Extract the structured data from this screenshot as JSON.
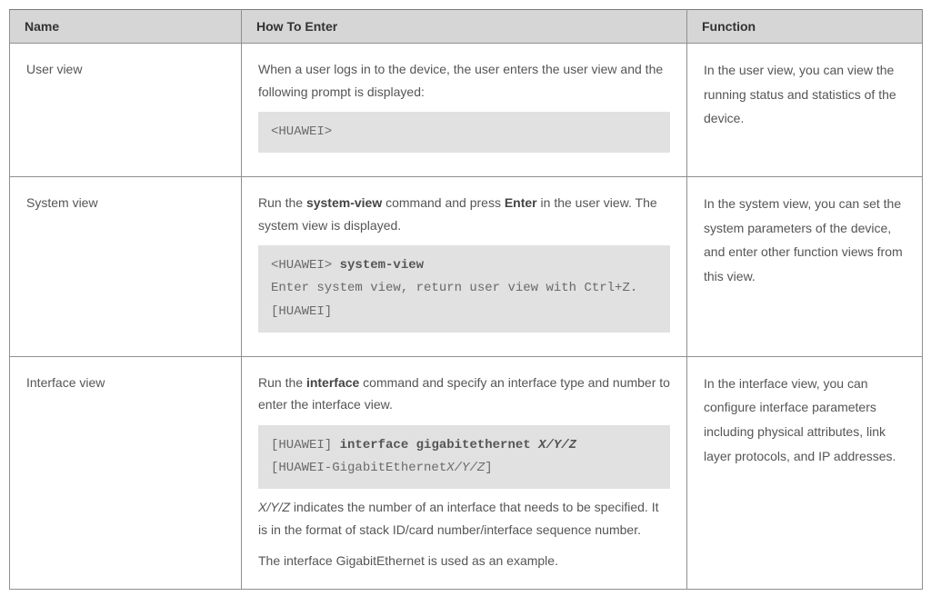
{
  "headers": {
    "name": "Name",
    "how": "How To Enter",
    "func": "Function"
  },
  "rows": [
    {
      "name": "User view",
      "how_intro": "When a user logs in to the device, the user enters the user view and the following prompt is displayed:",
      "code": {
        "line1": "<HUAWEI>"
      },
      "func": "In the user view, you can view the running status and statistics of the device."
    },
    {
      "name": "System view",
      "how_pre": "Run the ",
      "how_bold1": "system-view",
      "how_mid": " command and press ",
      "how_bold2": "Enter",
      "how_post": " in the user view. The system view is displayed.",
      "code": {
        "l1a": "<HUAWEI> ",
        "l1b": "system-view",
        "l2": "Enter system view, return user view with Ctrl+Z.",
        "l3": "[HUAWEI]"
      },
      "func": "In the system view, you can set the system parameters of the device, and enter other function views from this view."
    },
    {
      "name": "Interface view",
      "how_pre": "Run the ",
      "how_bold1": "interface",
      "how_post": " command and specify an interface type and number to enter the interface view.",
      "code": {
        "l1a": "[HUAWEI] ",
        "l1b": "interface gigabitethernet ",
        "l1c": "X/Y/Z",
        "l2a": "[HUAWEI-GigabitEthernet",
        "l2b": "X/Y/Z",
        "l2c": "]"
      },
      "note1_italic": "X/Y/Z",
      "note1_rest": " indicates the number of an interface that needs to be specified. It is in the format of stack ID/card number/interface sequence number.",
      "note2": "The interface GigabitEthernet is used as an example.",
      "func": "In the interface view, you can configure interface parameters including physical attributes, link layer protocols, and IP addresses."
    }
  ]
}
